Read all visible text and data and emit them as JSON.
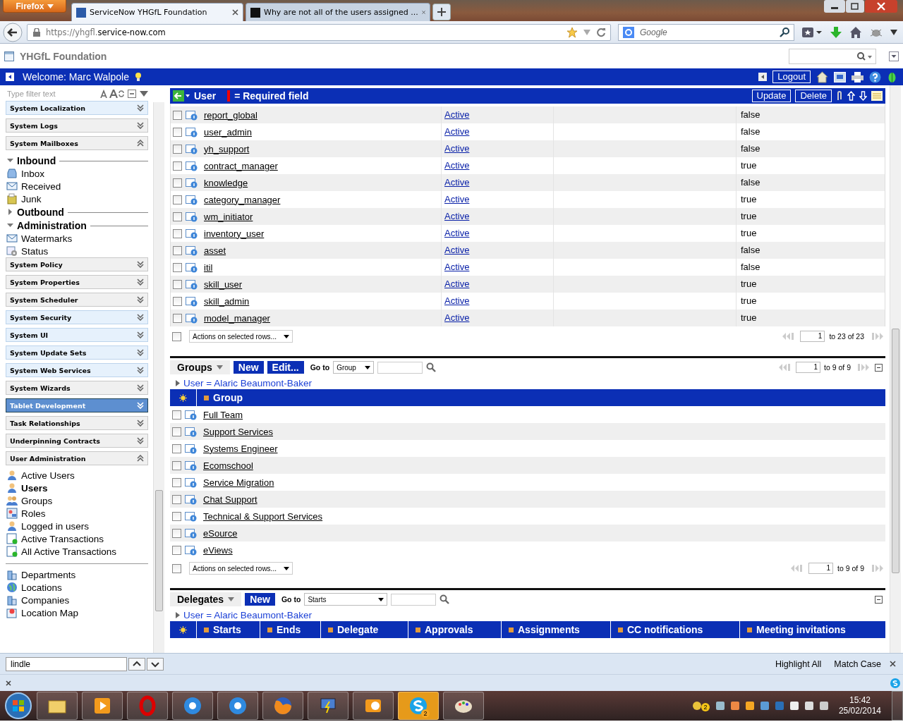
{
  "browser": {
    "menu_button": "Firefox",
    "tabs": [
      {
        "title": "ServiceNow YHGfL Foundation",
        "selected": true
      },
      {
        "title": "Why are not all of the users assigned ...",
        "selected": false
      }
    ],
    "url_prefix": "https://yhgfl.",
    "url_domain": "service-now.com",
    "search_placeholder": "Google"
  },
  "app": {
    "title": "YHGfL Foundation",
    "welcome": "Welcome: Marc Walpole",
    "logout": "Logout"
  },
  "sidebar": {
    "filter_placeholder": "Type filter text",
    "items": [
      {
        "kind": "section",
        "label": "System Localization",
        "highlighted": true,
        "selected": false,
        "expanded": false
      },
      {
        "kind": "section",
        "label": "System Logs",
        "highlighted": false,
        "selected": false,
        "expanded": false
      },
      {
        "kind": "section",
        "label": "System Mailboxes",
        "highlighted": false,
        "selected": false,
        "expanded": true
      },
      {
        "kind": "heading",
        "label": "Inbound",
        "expanded": true
      },
      {
        "kind": "module",
        "label": "Inbox",
        "bold": false
      },
      {
        "kind": "module",
        "label": "Received",
        "bold": false
      },
      {
        "kind": "module",
        "label": "Junk",
        "bold": false
      },
      {
        "kind": "heading",
        "label": "Outbound",
        "expanded": false
      },
      {
        "kind": "heading",
        "label": "Administration",
        "expanded": true
      },
      {
        "kind": "module",
        "label": "Watermarks",
        "bold": false
      },
      {
        "kind": "module",
        "label": "Status",
        "bold": false
      },
      {
        "kind": "section",
        "label": "System Policy",
        "highlighted": false,
        "selected": false,
        "expanded": false
      },
      {
        "kind": "section",
        "label": "System Properties",
        "highlighted": false,
        "selected": false,
        "expanded": false
      },
      {
        "kind": "section",
        "label": "System Scheduler",
        "highlighted": false,
        "selected": false,
        "expanded": false
      },
      {
        "kind": "section",
        "label": "System Security",
        "highlighted": true,
        "selected": false,
        "expanded": false
      },
      {
        "kind": "section",
        "label": "System UI",
        "highlighted": true,
        "selected": false,
        "expanded": false
      },
      {
        "kind": "section",
        "label": "System Update Sets",
        "highlighted": true,
        "selected": false,
        "expanded": false
      },
      {
        "kind": "section",
        "label": "System Web Services",
        "highlighted": true,
        "selected": false,
        "expanded": false
      },
      {
        "kind": "section",
        "label": "System Wizards",
        "highlighted": false,
        "selected": false,
        "expanded": false
      },
      {
        "kind": "section",
        "label": "Tablet Development",
        "highlighted": false,
        "selected": true,
        "expanded": false
      },
      {
        "kind": "section",
        "label": "Task Relationships",
        "highlighted": false,
        "selected": false,
        "expanded": false
      },
      {
        "kind": "section",
        "label": "Underpinning Contracts",
        "highlighted": false,
        "selected": false,
        "expanded": false
      },
      {
        "kind": "section",
        "label": "User Administration",
        "highlighted": false,
        "selected": false,
        "expanded": true
      },
      {
        "kind": "module",
        "label": "Active Users",
        "bold": false
      },
      {
        "kind": "module",
        "label": "Users",
        "bold": true
      },
      {
        "kind": "module",
        "label": "Groups",
        "bold": false
      },
      {
        "kind": "module",
        "label": "Roles",
        "bold": false
      },
      {
        "kind": "module",
        "label": "Logged in users",
        "bold": false
      },
      {
        "kind": "module",
        "label": "Active Transactions",
        "bold": false
      },
      {
        "kind": "module",
        "label": "All Active Transactions",
        "bold": false
      },
      {
        "kind": "separator"
      },
      {
        "kind": "module",
        "label": "Departments",
        "bold": false
      },
      {
        "kind": "module",
        "label": "Locations",
        "bold": false
      },
      {
        "kind": "module",
        "label": "Companies",
        "bold": false
      },
      {
        "kind": "module",
        "label": "Location Map",
        "bold": false
      }
    ]
  },
  "form": {
    "title": "User",
    "required_note": "= Required field",
    "buttons": [
      "Update",
      "Delete"
    ]
  },
  "roles": {
    "rows": [
      {
        "name": "report_global",
        "state": "Active",
        "value": "false",
        "checked": false
      },
      {
        "name": "user_admin",
        "state": "Active",
        "value": "false",
        "checked": false
      },
      {
        "name": "yh_support",
        "state": "Active",
        "value": "false",
        "checked": false
      },
      {
        "name": "contract_manager",
        "state": "Active",
        "value": "true",
        "checked": false
      },
      {
        "name": "knowledge",
        "state": "Active",
        "value": "false",
        "checked": false
      },
      {
        "name": "category_manager",
        "state": "Active",
        "value": "true",
        "checked": false
      },
      {
        "name": "wm_initiator",
        "state": "Active",
        "value": "true",
        "checked": false
      },
      {
        "name": "inventory_user",
        "state": "Active",
        "value": "true",
        "checked": false
      },
      {
        "name": "asset",
        "state": "Active",
        "value": "false",
        "checked": false
      },
      {
        "name": "itil",
        "state": "Active",
        "value": "false",
        "checked": false
      },
      {
        "name": "skill_user",
        "state": "Active",
        "value": "true",
        "checked": false
      },
      {
        "name": "skill_admin",
        "state": "Active",
        "value": "true",
        "checked": false
      },
      {
        "name": "model_manager",
        "state": "Active",
        "value": "true",
        "checked": false
      }
    ],
    "all_checked": false,
    "actions": "Actions on selected rows...",
    "page": "1",
    "range": "to 23 of 23"
  },
  "groups": {
    "title": "Groups",
    "buttons": [
      "New",
      "Edit..."
    ],
    "goto_label": "Go to",
    "goto_field": "Group",
    "top_page": "1",
    "top_range": "to 9 of 9",
    "breadcrumb": "User = Alaric Beaumont-Baker",
    "columns": [
      "Group"
    ],
    "rows": [
      {
        "name": "Full Team",
        "checked": false
      },
      {
        "name": "Support Services",
        "checked": false
      },
      {
        "name": "Systems Engineer",
        "checked": false
      },
      {
        "name": "Ecomschool",
        "checked": false
      },
      {
        "name": "Service Migration",
        "checked": false
      },
      {
        "name": "Chat Support",
        "checked": false
      },
      {
        "name": "Technical & Support Services",
        "checked": false
      },
      {
        "name": "eSource",
        "checked": false
      },
      {
        "name": "eViews",
        "checked": false
      }
    ],
    "all_checked": false,
    "actions": "Actions on selected rows...",
    "page": "1",
    "range": "to 9 of 9"
  },
  "delegates": {
    "title": "Delegates",
    "buttons": [
      "New"
    ],
    "goto_label": "Go to",
    "goto_field": "Starts",
    "breadcrumb": "User = Alaric Beaumont-Baker",
    "columns": [
      "Starts",
      "Ends",
      "Delegate",
      "Approvals",
      "Assignments",
      "CC notifications",
      "Meeting invitations"
    ]
  },
  "find_bar": {
    "value": "lindle",
    "highlight_all": "Highlight All",
    "match_case": "Match Case"
  },
  "taskbar": {
    "skype_badge": "2",
    "tray_badge": "2",
    "time": "15:42",
    "date": "25/02/2014"
  }
}
